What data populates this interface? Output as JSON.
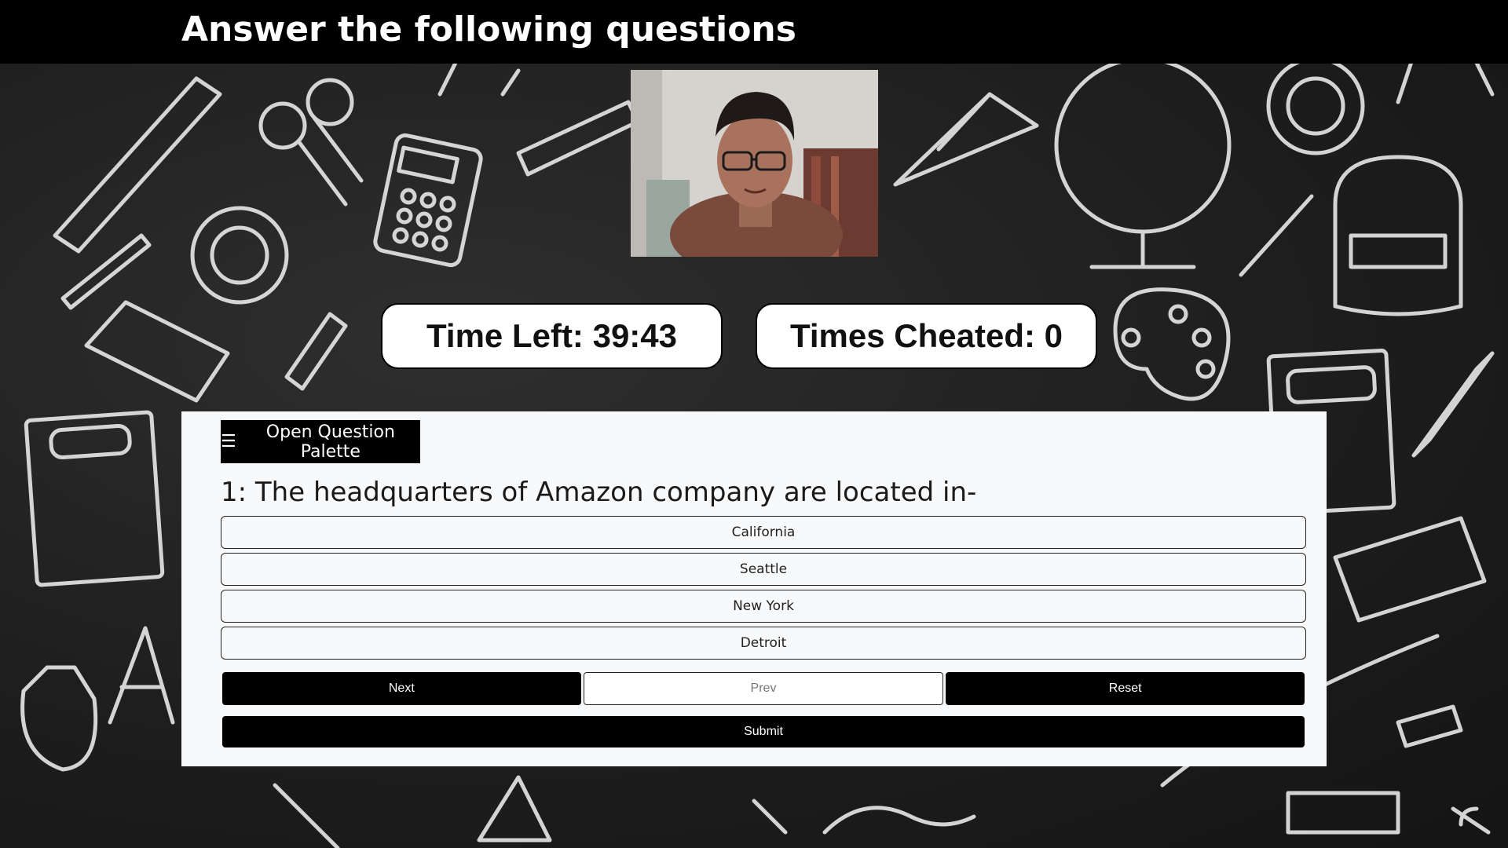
{
  "header": {
    "title": "Answer the following questions"
  },
  "webcam": {
    "icon": "person-icon"
  },
  "stats": {
    "time_left_label": "Time Left: 39:43",
    "times_cheated_label": "Times Cheated: 0"
  },
  "quiz": {
    "palette_icon": "☰",
    "palette_label": "Open Question Palette",
    "question": "1: The headquarters of Amazon company are located in-",
    "options": [
      "California",
      "Seattle",
      "New York",
      "Detroit"
    ],
    "next_label": "Next",
    "prev_label": "Prev",
    "reset_label": "Reset",
    "submit_label": "Submit"
  },
  "colors": {
    "topbar": "#000000",
    "card": "#f8f9fa",
    "button_dark": "#000000"
  }
}
